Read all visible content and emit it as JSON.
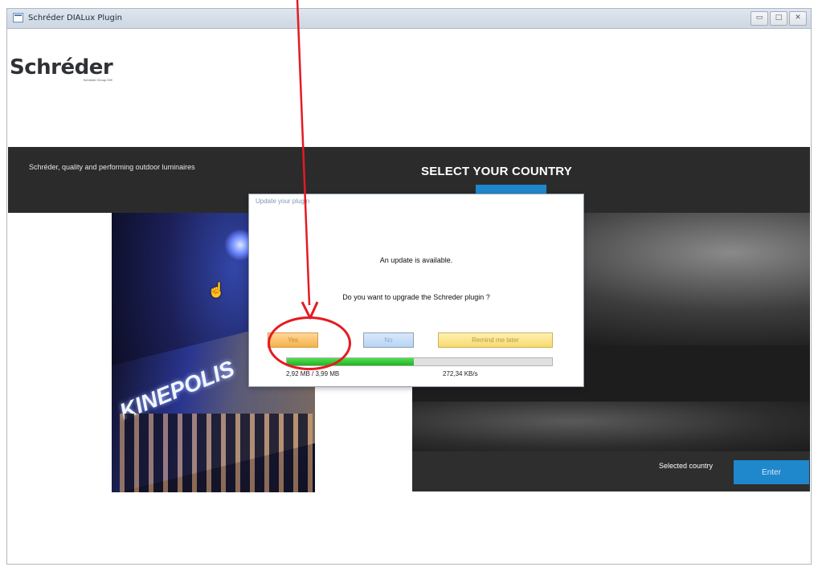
{
  "window": {
    "title": "Schréder DIALux Plugin",
    "controls": [
      "▭",
      "□",
      "✕"
    ]
  },
  "brand": {
    "name": "Schréder",
    "group_label": "Schréder Group GIE"
  },
  "header": {
    "tagline": "Schréder, quality and performing outdoor luminaires",
    "title": "SELECT YOUR COUNTRY"
  },
  "photo": {
    "sign_text": "KINEPOLIS"
  },
  "footer_panel": {
    "selected_country_label": "Selected country",
    "enter_label": "Enter"
  },
  "dialog": {
    "title": "Update your plugin",
    "message": "An update is available.",
    "question": "Do you want to upgrade the Schreder plugin ?",
    "yes_label": "Yes",
    "no_label": "No",
    "later_label": "Remind me later",
    "progress_fraction": 0.48,
    "progress_amount": "2,92 MB / 3,99 MB",
    "progress_rate": "272,34 KB/s"
  },
  "colors": {
    "header_bg": "#2b2b2b",
    "accent_blue": "#1f87cb",
    "annotation_red": "#e51a22",
    "progress_green": "#22b322"
  }
}
